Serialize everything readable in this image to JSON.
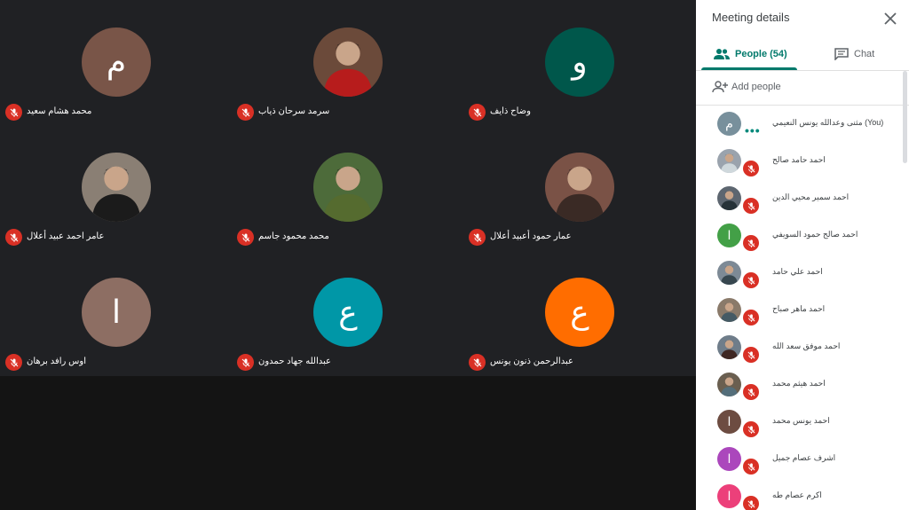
{
  "grid": {
    "tiles": [
      {
        "name": "محمد هشام سعيد",
        "initial": "م",
        "color": "#795548"
      },
      {
        "name": "سرمد سرحان ذياب",
        "initial": "",
        "color": "#6b4a3a"
      },
      {
        "name": "وضاح ذايف",
        "initial": "و",
        "color": "#00574b"
      },
      {
        "name": "عامر احمد عبيد أعلال",
        "initial": "",
        "color": "#8a7f74"
      },
      {
        "name": "محمد محمود جاسم",
        "initial": "",
        "color": "#4d6b3a"
      },
      {
        "name": "عمار حمود أعبيد أعلال",
        "initial": "",
        "color": "#7a5246"
      },
      {
        "name": "اوس رافد برهان",
        "initial": "ا",
        "color": "#8d6e63"
      },
      {
        "name": "عبدالله جهاد حمدون",
        "initial": "ع",
        "color": "#0097a7"
      },
      {
        "name": "عبدالرحمن ذنون يونس",
        "initial": "ع",
        "color": "#ff6d00"
      }
    ]
  },
  "panel": {
    "title": "Meeting details",
    "tabs": {
      "people": "People (54)",
      "chat": "Chat"
    },
    "add_people": "Add people",
    "participants": [
      {
        "name": "مثنى وعدالله يونس النعيمي (You)",
        "initial": "م",
        "color": "#78909c",
        "photo": false,
        "self": true
      },
      {
        "name": "احمد حامد صالح",
        "initial": "",
        "color": "#9aa3ad",
        "photo": true,
        "self": false
      },
      {
        "name": "احمد سمير محيي الدين",
        "initial": "",
        "color": "#5d6670",
        "photo": true,
        "self": false
      },
      {
        "name": "احمد صالح حمود السويفي",
        "initial": "ا",
        "color": "#43a047",
        "photo": false,
        "self": false
      },
      {
        "name": "احمد علي حامد",
        "initial": "",
        "color": "#7d8a96",
        "photo": true,
        "self": false
      },
      {
        "name": "احمد ماهر صباح",
        "initial": "",
        "color": "#8a7a6a",
        "photo": true,
        "self": false
      },
      {
        "name": "احمد موفق سعد الله",
        "initial": "",
        "color": "#6f7d8a",
        "photo": true,
        "self": false
      },
      {
        "name": "احمد هيثم محمد",
        "initial": "",
        "color": "#6a5f50",
        "photo": true,
        "self": false
      },
      {
        "name": "احمد يونس محمد",
        "initial": "ا",
        "color": "#6d4c41",
        "photo": false,
        "self": false
      },
      {
        "name": "اشرف عصام جميل",
        "initial": "ا",
        "color": "#ab47bc",
        "photo": false,
        "self": false
      },
      {
        "name": "اكرم عصام طه",
        "initial": "ا",
        "color": "#ec407a",
        "photo": false,
        "self": false
      }
    ]
  },
  "colors": {
    "accent": "#00796b",
    "mic_off": "#d93025",
    "tile_bg": "#202124"
  }
}
